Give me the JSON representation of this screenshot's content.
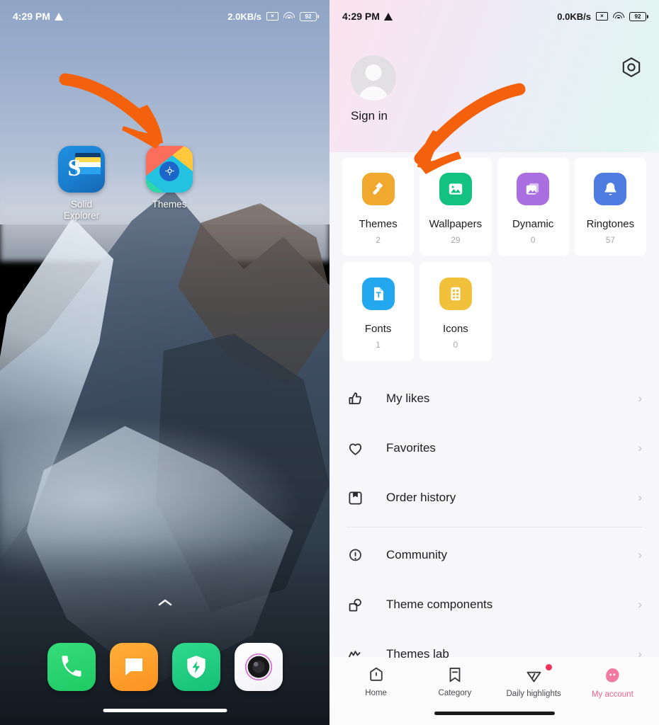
{
  "left_screen": {
    "status_bar": {
      "time": "4:29 PM",
      "warning_icon": "warning-triangle-icon",
      "network_speed": "2.0KB/s",
      "nosim_icon": "no-sim-icon",
      "nosim_glyph": "×",
      "wifi_icon": "wifi-icon",
      "battery_icon": "battery-icon",
      "battery_level": "92"
    },
    "apps": [
      {
        "label": "Solid\nExplorer",
        "label_line1": "Solid",
        "label_line2": "Explorer",
        "icon": "solid-explorer-icon"
      },
      {
        "label": "Themes",
        "icon": "themes-app-icon"
      }
    ],
    "drawer_arrow": "ⱏ",
    "drawer_arrow_glyph": "▲",
    "dock": [
      {
        "name": "phone-icon",
        "label": "Phone"
      },
      {
        "name": "messages-icon",
        "label": "Messages"
      },
      {
        "name": "security-icon",
        "label": "Security"
      },
      {
        "name": "camera-icon",
        "label": "Camera"
      }
    ],
    "annotation": {
      "name": "orange-arrow-annotation",
      "color": "#f4610d"
    }
  },
  "right_screen": {
    "status_bar": {
      "time": "4:29 PM",
      "warning_icon": "warning-triangle-icon",
      "network_speed": "0.0KB/s",
      "nosim_icon": "no-sim-icon",
      "nosim_glyph": "×",
      "wifi_icon": "wifi-icon",
      "battery_icon": "battery-icon",
      "battery_level": "92"
    },
    "header": {
      "avatar": "default-avatar",
      "sign_in_label": "Sign in",
      "settings_icon": "settings-gear-icon"
    },
    "grid": [
      {
        "label": "Themes",
        "count": "2",
        "icon": "themes-roller-icon",
        "color": "#f0a82e"
      },
      {
        "label": "Wallpapers",
        "count": "29",
        "icon": "wallpaper-icon",
        "color": "#13c281"
      },
      {
        "label": "Dynamic",
        "count": "0",
        "icon": "dynamic-wallpaper-icon",
        "color": "#a96fe0"
      },
      {
        "label": "Ringtones",
        "count": "57",
        "icon": "bell-icon",
        "color": "#4e7ce0"
      },
      {
        "label": "Fonts",
        "count": "1",
        "icon": "font-file-icon",
        "color": "#23a8f0"
      },
      {
        "label": "Icons",
        "count": "0",
        "icon": "icons-pack-icon",
        "color": "#f2c13c"
      }
    ],
    "list_group_1": [
      {
        "label": "My likes",
        "icon": "thumbs-up-icon",
        "chevron": "›"
      },
      {
        "label": "Favorites",
        "icon": "heart-icon",
        "chevron": "›"
      },
      {
        "label": "Order history",
        "icon": "bookmark-icon",
        "chevron": "›"
      }
    ],
    "list_group_2": [
      {
        "label": "Community",
        "icon": "community-icon",
        "chevron": "›"
      },
      {
        "label": "Theme components",
        "icon": "theme-components-icon",
        "chevron": "›"
      },
      {
        "label": "Themes lab",
        "icon": "themes-lab-icon",
        "chevron": "›"
      }
    ],
    "bottom_nav": [
      {
        "label": "Home",
        "icon": "home-icon",
        "active": false,
        "badge": false
      },
      {
        "label": "Category",
        "icon": "category-icon",
        "active": false,
        "badge": false
      },
      {
        "label": "Daily highlights",
        "icon": "daily-highlights-icon",
        "active": false,
        "badge": true
      },
      {
        "label": "My account",
        "icon": "my-account-icon",
        "active": true,
        "badge": false
      }
    ],
    "accent_color": "#f0638e",
    "badge_color": "#f0315c",
    "annotation": {
      "name": "orange-arrow-annotation",
      "color": "#f4610d"
    }
  }
}
